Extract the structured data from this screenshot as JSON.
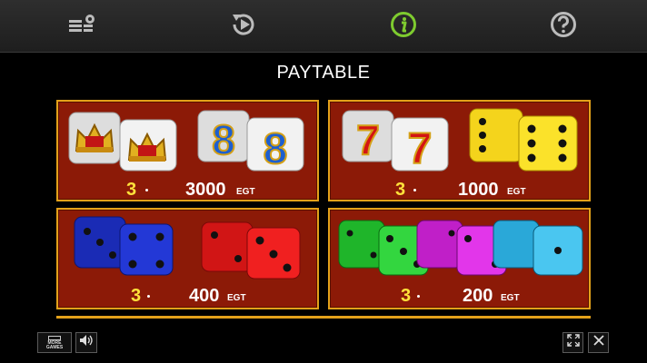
{
  "topbar": {
    "buttons": [
      {
        "icon": "paytable-settings-icon"
      },
      {
        "icon": "replay-icon"
      },
      {
        "icon": "info-icon",
        "active_color": "#7ecb2f"
      },
      {
        "icon": "help-icon"
      }
    ]
  },
  "title": "PAYTABLE",
  "paytable": [
    {
      "symbols": [
        "crown-die",
        "eight-die"
      ],
      "count": "3",
      "amount": "3000",
      "unit": "EGT"
    },
    {
      "symbols": [
        "seven-die",
        "yellow-die"
      ],
      "count": "3",
      "amount": "1000",
      "unit": "EGT"
    },
    {
      "symbols": [
        "blue-die",
        "red-die"
      ],
      "count": "3",
      "amount": "400",
      "unit": "EGT"
    },
    {
      "symbols": [
        "green-die",
        "magenta-die",
        "cyan-die"
      ],
      "count": "3",
      "amount": "200",
      "unit": "EGT"
    }
  ],
  "bottom": {
    "more_games_line1": "MORE",
    "more_games_line2": "GAMES",
    "sound_icon": "speaker-icon",
    "fullscreen_icon": "fullscreen-icon",
    "close_icon": "close-icon"
  },
  "colors": {
    "panel_bg": "#8c1a07",
    "panel_border": "#e3a11a",
    "count_color": "#ffe23b",
    "info_active": "#7ecb2f"
  }
}
